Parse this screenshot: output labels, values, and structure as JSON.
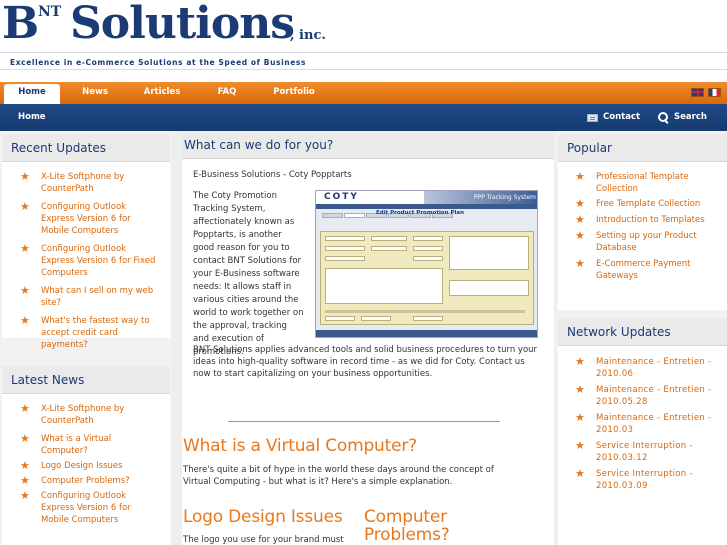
{
  "brand": {
    "logo_b": "B",
    "logo_nt": "NT",
    "logo_solutions": "Solutions",
    "logo_inc": ", inc.",
    "tagline": "Excellence in e-Commerce Solutions at the Speed of Business"
  },
  "nav": {
    "items": [
      {
        "label": "Home"
      },
      {
        "label": "News"
      },
      {
        "label": "Articles"
      },
      {
        "label": "FAQ"
      },
      {
        "label": "Portfolio"
      }
    ],
    "active": "Home"
  },
  "subnav": {
    "home": "Home",
    "contact": "Contact",
    "search": "Search"
  },
  "left": {
    "recent_title": "Recent Updates",
    "recent_items": [
      {
        "label": "X-Lite Softphone by CounterPath"
      },
      {
        "label": "Configuring Outlook Express Version 6 for Mobile Computers"
      },
      {
        "label": "Configuring Outlook Express Version 6 for Fixed Computers"
      },
      {
        "label": "What can I sell on my web site?"
      },
      {
        "label": "What's the fastest way to accept credit card payments?"
      }
    ],
    "news_title": "Latest News",
    "news_items": [
      {
        "label": "X-Lite Softphone by CounterPath"
      },
      {
        "label": "What is a Virtual Computer?"
      },
      {
        "label": "Logo Design Issues"
      },
      {
        "label": "Computer Problems?"
      },
      {
        "label": "Configuring Outlook Express Version 6 for Mobile Computers"
      }
    ]
  },
  "main": {
    "title": "What can we do for you?",
    "subtitle": "E-Business Solutions - Coty Popptarts",
    "para1": "The Coty Promotion Tracking System, affectionately known as Popptarts, is another good reason for you to contact BNT Solutions for your E-Business software needs: It allows staff in various cities around the world to work together on the approval, tracking and execution of promotions.",
    "para2": "BNT Solutions applies advanced tools and solid business procedures to turn your ideas into high-quality software in record time - as we did for Coty. Contact us now to start capitalizing on your business opportunities.",
    "screenshot": {
      "logo": "COTY",
      "band": "PPP Tracking System",
      "form_title": "Edit Product Promotion Plan"
    },
    "article1_title": "What is a Virtual Computer?",
    "article1_text": "There's quite a bit of hype in the world these days around the concept of Virtual Computing - but what is it? Here's a simple explanation.",
    "article2_title": "Logo Design Issues",
    "article2_text": "The logo you use for your brand must",
    "article3_title": "Computer Problems?"
  },
  "right": {
    "popular_title": "Popular",
    "popular_items": [
      {
        "label": "Professional Template Collection"
      },
      {
        "label": "Free Template Collection"
      },
      {
        "label": "Introduction to Templates"
      },
      {
        "label": "Setting up your Product Database"
      },
      {
        "label": "E-Commerce Payment Gateways"
      }
    ],
    "network_title": "Network Updates",
    "network_items": [
      {
        "label": "Maintenance - Entretien - 2010.06"
      },
      {
        "label": "Maintenance - Entretien - 2010.05.28"
      },
      {
        "label": "Maintenance - Entretien - 2010.03"
      },
      {
        "label": "Service Interruption - 2010.03.12"
      },
      {
        "label": "Service Interruption - 2010.03.09"
      }
    ]
  },
  "colors": {
    "brand_blue": "#1c3a73",
    "accent_orange": "#e8781c",
    "link_orange": "#d9670a"
  },
  "icons": {
    "contact": "contact-card-icon",
    "search": "search-icon",
    "bullet": "star-icon",
    "lang_en": "uk-flag-icon",
    "lang_fr": "france-flag-icon"
  }
}
